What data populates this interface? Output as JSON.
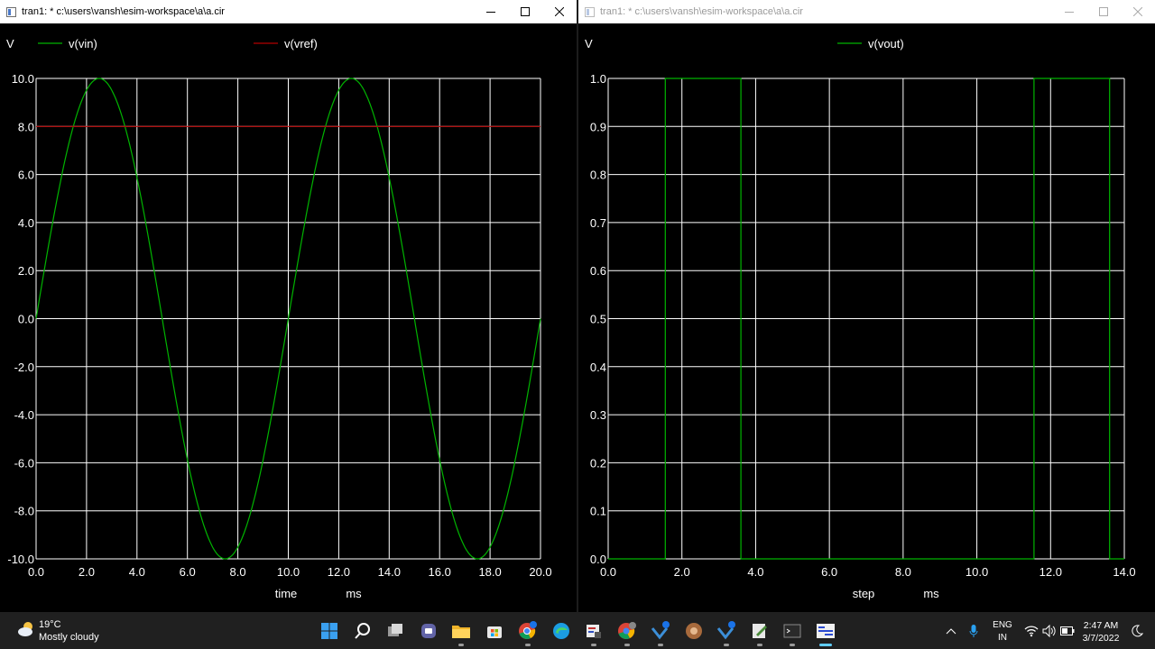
{
  "windows": [
    {
      "id": "left",
      "title": "tran1: * c:\\users\\vansh\\esim-workspace\\a\\a.cir",
      "active": true
    },
    {
      "id": "right",
      "title": "tran1: * c:\\users\\vansh\\esim-workspace\\a\\a.cir",
      "active": false
    }
  ],
  "colors": {
    "background": "#000000",
    "grid": "#ffffff",
    "trace_green": "#00b400",
    "trace_red": "#b40000"
  },
  "chart_data": [
    {
      "type": "line",
      "title": "",
      "ylabel": "V",
      "xlabel": "time",
      "xunit": "ms",
      "xlim": [
        0,
        20
      ],
      "ylim": [
        -10,
        10
      ],
      "x_ticks": [
        "0.0",
        "2.0",
        "4.0",
        "6.0",
        "8.0",
        "10.0",
        "12.0",
        "14.0",
        "16.0",
        "18.0",
        "20.0"
      ],
      "y_ticks": [
        "10.0",
        "8.0",
        "6.0",
        "4.0",
        "2.0",
        "0.0",
        "-2.0",
        "-4.0",
        "-6.0",
        "-8.0",
        "-10.0"
      ],
      "grid": true,
      "legend": "top",
      "series": [
        {
          "name": "v(vin)",
          "color": "#00b400",
          "kind": "sine",
          "amplitude": 10,
          "period": 10,
          "offset": 0
        },
        {
          "name": "v(vref)",
          "color": "#b40000",
          "kind": "constant",
          "value": 8
        }
      ]
    },
    {
      "type": "line",
      "title": "",
      "ylabel": "V",
      "xlabel": "step",
      "xunit": "ms",
      "xlim": [
        0,
        14
      ],
      "ylim": [
        0,
        1
      ],
      "x_ticks": [
        "0.0",
        "2.0",
        "4.0",
        "6.0",
        "8.0",
        "10.0",
        "12.0",
        "14.0"
      ],
      "y_ticks": [
        "1.0",
        "0.9",
        "0.8",
        "0.7",
        "0.6",
        "0.5",
        "0.4",
        "0.3",
        "0.2",
        "0.1",
        "0.0"
      ],
      "grid": true,
      "legend": "top",
      "series": [
        {
          "name": "v(vout)",
          "color": "#00b400",
          "kind": "steps",
          "x": [
            0,
            1.55,
            1.55,
            3.6,
            3.6,
            11.55,
            11.55,
            13.6,
            13.6,
            14.0
          ],
          "y": [
            0,
            0,
            1,
            1,
            0,
            0,
            1,
            1,
            0,
            0
          ]
        }
      ]
    }
  ],
  "taskbar": {
    "weather": {
      "temp": "19°C",
      "desc": "Mostly cloudy",
      "icon": "partly-cloudy-icon"
    },
    "apps": [
      "start-icon",
      "search-icon",
      "task-view-icon",
      "chat-icon",
      "file-explorer-icon",
      "store-icon",
      "chrome-icon",
      "edge-icon",
      "ngspice-app-icon",
      "chrome-profile-icon",
      "esim-icon",
      "circle-app-icon",
      "esim-icon-2",
      "editor-icon",
      "terminal-icon",
      "ngspice-plot-icon"
    ],
    "tray": {
      "lang": "ENG",
      "region": "IN",
      "time": "2:47 AM",
      "date": "3/7/2022"
    }
  }
}
